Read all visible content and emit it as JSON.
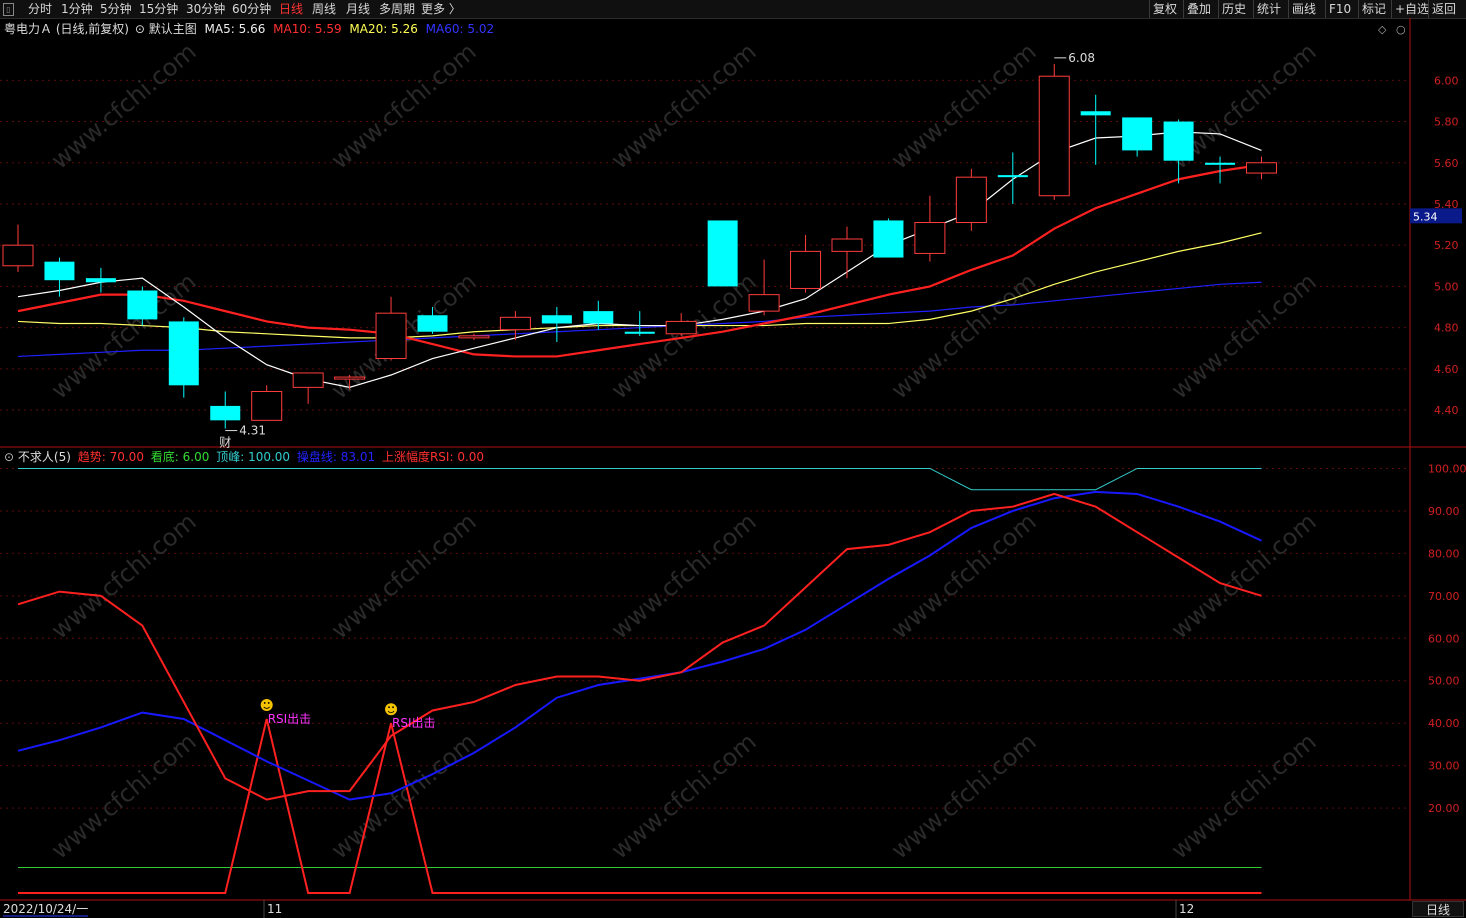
{
  "toolbar": {
    "tabs": [
      "分时",
      "1分钟",
      "5分钟",
      "15分钟",
      "30分钟",
      "60分钟",
      "日线",
      "周线",
      "月线",
      "多周期",
      "更多 〉"
    ],
    "active_tab": "日线",
    "right_buttons": [
      "复权",
      "叠加",
      "历史",
      "统计",
      "画线",
      "F10",
      "标记",
      "+自选",
      "返回"
    ]
  },
  "main_legend": {
    "title": "粤电力Ａ (日线,前复权)",
    "indicator": "默认主图",
    "ma5_label": "MA5:",
    "ma5": "5.66",
    "ma10_label": "MA10:",
    "ma10": "5.59",
    "ma20_label": "MA20:",
    "ma20": "5.26",
    "ma60_label": "MA60:",
    "ma60": "5.02"
  },
  "sub_legend": {
    "title": "不求人(5)",
    "trend_label": "趋势:",
    "trend": "70.00",
    "bottom_label": "看底:",
    "bottom": "6.00",
    "top_label": "顶峰:",
    "top": "100.00",
    "ctrl_label": "操盘线:",
    "ctrl": "83.01",
    "rsi_label": "上涨幅度RSI:",
    "rsi": "0.00"
  },
  "annotations": {
    "high_label": "6.08",
    "low_label": "4.31",
    "cai_label": "财",
    "rsi_signal": "RSI出击"
  },
  "price_tag": "5.34",
  "watermark": "www.cfchi.com",
  "date_labels": {
    "start": "2022/10/24/一",
    "nov": "11",
    "dec": "12"
  },
  "period_button": "日线",
  "colors": {
    "up": "#ff3c3c",
    "down": "#00ffff",
    "ma5": "#ffffff",
    "ma10": "#ff2020",
    "ma20": "#ffff66",
    "ma60": "#2020ff",
    "trend": "#ff2020",
    "ctrl": "#1818ff",
    "top": "#33cccc",
    "bottom": "#33cc33",
    "rsi": "#ff2020",
    "axis": "#b01010"
  },
  "chart_data": [
    {
      "type": "candlestick",
      "title": "粤电力Ａ (日线,前复权)",
      "yaxis_ticks": [
        6.0,
        5.8,
        5.6,
        5.4,
        5.2,
        5.0,
        4.8,
        4.6,
        4.4
      ],
      "ylim": [
        4.24,
        6.22
      ],
      "candles": [
        {
          "o": 5.1,
          "h": 5.3,
          "l": 5.07,
          "c": 5.2
        },
        {
          "o": 5.12,
          "h": 5.14,
          "l": 4.95,
          "c": 5.03
        },
        {
          "o": 5.04,
          "h": 5.09,
          "l": 4.97,
          "c": 5.02
        },
        {
          "o": 4.98,
          "h": 5.0,
          "l": 4.81,
          "c": 4.84
        },
        {
          "o": 4.83,
          "h": 4.85,
          "l": 4.46,
          "c": 4.52
        },
        {
          "o": 4.42,
          "h": 4.49,
          "l": 4.31,
          "c": 4.35
        },
        {
          "o": 4.35,
          "h": 4.52,
          "l": 4.35,
          "c": 4.49
        },
        {
          "o": 4.51,
          "h": 4.58,
          "l": 4.43,
          "c": 4.58
        },
        {
          "o": 4.56,
          "h": 4.57,
          "l": 4.5,
          "c": 4.56
        },
        {
          "o": 4.65,
          "h": 4.95,
          "l": 4.64,
          "c": 4.87
        },
        {
          "o": 4.86,
          "h": 4.9,
          "l": 4.77,
          "c": 4.78
        },
        {
          "o": 4.76,
          "h": 4.77,
          "l": 4.74,
          "c": 4.76
        },
        {
          "o": 4.79,
          "h": 4.88,
          "l": 4.74,
          "c": 4.85
        },
        {
          "o": 4.86,
          "h": 4.9,
          "l": 4.73,
          "c": 4.82
        },
        {
          "o": 4.88,
          "h": 4.93,
          "l": 4.79,
          "c": 4.82
        },
        {
          "o": 4.78,
          "h": 4.88,
          "l": 4.76,
          "c": 4.77
        },
        {
          "o": 4.77,
          "h": 4.87,
          "l": 4.76,
          "c": 4.83
        },
        {
          "o": 5.32,
          "h": 5.32,
          "l": 5.0,
          "c": 5.0
        },
        {
          "o": 4.88,
          "h": 5.13,
          "l": 4.86,
          "c": 4.96
        },
        {
          "o": 4.99,
          "h": 5.25,
          "l": 4.97,
          "c": 5.17
        },
        {
          "o": 5.17,
          "h": 5.29,
          "l": 5.04,
          "c": 5.23
        },
        {
          "o": 5.32,
          "h": 5.33,
          "l": 5.14,
          "c": 5.14
        },
        {
          "o": 5.16,
          "h": 5.44,
          "l": 5.12,
          "c": 5.31
        },
        {
          "o": 5.31,
          "h": 5.57,
          "l": 5.27,
          "c": 5.53
        },
        {
          "o": 5.54,
          "h": 5.65,
          "l": 5.4,
          "c": 5.53
        },
        {
          "o": 5.44,
          "h": 6.08,
          "l": 5.42,
          "c": 6.02
        },
        {
          "o": 5.85,
          "h": 5.93,
          "l": 5.59,
          "c": 5.83
        },
        {
          "o": 5.82,
          "h": 5.82,
          "l": 5.63,
          "c": 5.66
        },
        {
          "o": 5.8,
          "h": 5.81,
          "l": 5.5,
          "c": 5.61
        },
        {
          "o": 5.6,
          "h": 5.63,
          "l": 5.5,
          "c": 5.59
        },
        {
          "o": 5.55,
          "h": 5.63,
          "l": 5.52,
          "c": 5.6
        }
      ],
      "ma5": [
        4.95,
        4.98,
        5.02,
        5.04,
        4.9,
        4.75,
        4.62,
        4.55,
        4.51,
        4.57,
        4.65,
        4.7,
        4.75,
        4.8,
        4.82,
        4.81,
        4.81,
        4.84,
        4.88,
        4.94,
        5.07,
        5.2,
        5.28,
        5.36,
        5.52,
        5.65,
        5.72,
        5.73,
        5.75,
        5.74,
        5.66
      ],
      "ma10": [
        4.88,
        4.92,
        4.96,
        4.96,
        4.93,
        4.88,
        4.83,
        4.8,
        4.79,
        4.77,
        4.72,
        4.67,
        4.66,
        4.66,
        4.69,
        4.72,
        4.75,
        4.78,
        4.82,
        4.86,
        4.91,
        4.96,
        5.0,
        5.08,
        5.15,
        5.28,
        5.38,
        5.45,
        5.52,
        5.56,
        5.59
      ],
      "ma20": [
        4.83,
        4.82,
        4.82,
        4.81,
        4.8,
        4.78,
        4.77,
        4.76,
        4.75,
        4.75,
        4.76,
        4.78,
        4.79,
        4.8,
        4.81,
        4.81,
        4.81,
        4.81,
        4.81,
        4.82,
        4.82,
        4.82,
        4.84,
        4.88,
        4.94,
        5.01,
        5.07,
        5.12,
        5.17,
        5.21,
        5.26
      ],
      "ma60": [
        4.66,
        4.67,
        4.68,
        4.69,
        4.69,
        4.7,
        4.71,
        4.72,
        4.73,
        4.74,
        4.75,
        4.76,
        4.77,
        4.78,
        4.79,
        4.8,
        4.81,
        4.82,
        4.83,
        4.85,
        4.86,
        4.87,
        4.88,
        4.9,
        4.91,
        4.93,
        4.95,
        4.97,
        4.99,
        5.01,
        5.02
      ]
    },
    {
      "type": "line",
      "title": "不求人(5)",
      "yaxis_ticks": [
        100.0,
        90.0,
        80.0,
        70.0,
        60.0,
        50.0,
        40.0,
        30.0,
        20.0
      ],
      "ylim": [
        0,
        102
      ],
      "series": [
        {
          "name": "趋势",
          "values": [
            68,
            71,
            70,
            63,
            45,
            27,
            22,
            24,
            24,
            37,
            43,
            45,
            49,
            51,
            51,
            50,
            52,
            59,
            63,
            72,
            81,
            82,
            85,
            90,
            91,
            94,
            91,
            85,
            79,
            73,
            70
          ]
        },
        {
          "name": "看底",
          "values": [
            6,
            6,
            6,
            6,
            6,
            6,
            6,
            6,
            6,
            6,
            6,
            6,
            6,
            6,
            6,
            6,
            6,
            6,
            6,
            6,
            6,
            6,
            6,
            6,
            6,
            6,
            6,
            6,
            6,
            6,
            6
          ]
        },
        {
          "name": "顶峰",
          "values": [
            100,
            100,
            100,
            100,
            100,
            100,
            100,
            100,
            100,
            100,
            100,
            100,
            100,
            100,
            100,
            100,
            100,
            100,
            100,
            100,
            100,
            100,
            100,
            95,
            95,
            95,
            95,
            100,
            100,
            100,
            100
          ]
        },
        {
          "name": "操盘线",
          "values": [
            33.5,
            36,
            39,
            42.5,
            41,
            36,
            31,
            26.5,
            22,
            23.5,
            28,
            33,
            39,
            46,
            49,
            50.5,
            52,
            54.5,
            57.5,
            62,
            68,
            74,
            79.5,
            86,
            90,
            93,
            94.5,
            94,
            91,
            87.5,
            83
          ]
        },
        {
          "name": "上涨幅度RSI",
          "values": [
            0,
            0,
            0,
            0,
            0,
            0,
            41,
            0,
            0,
            40,
            0,
            0,
            0,
            0,
            0,
            0,
            0,
            0,
            0,
            0,
            0,
            0,
            0,
            0,
            0,
            0,
            0,
            0,
            0,
            0,
            0
          ]
        }
      ]
    }
  ]
}
